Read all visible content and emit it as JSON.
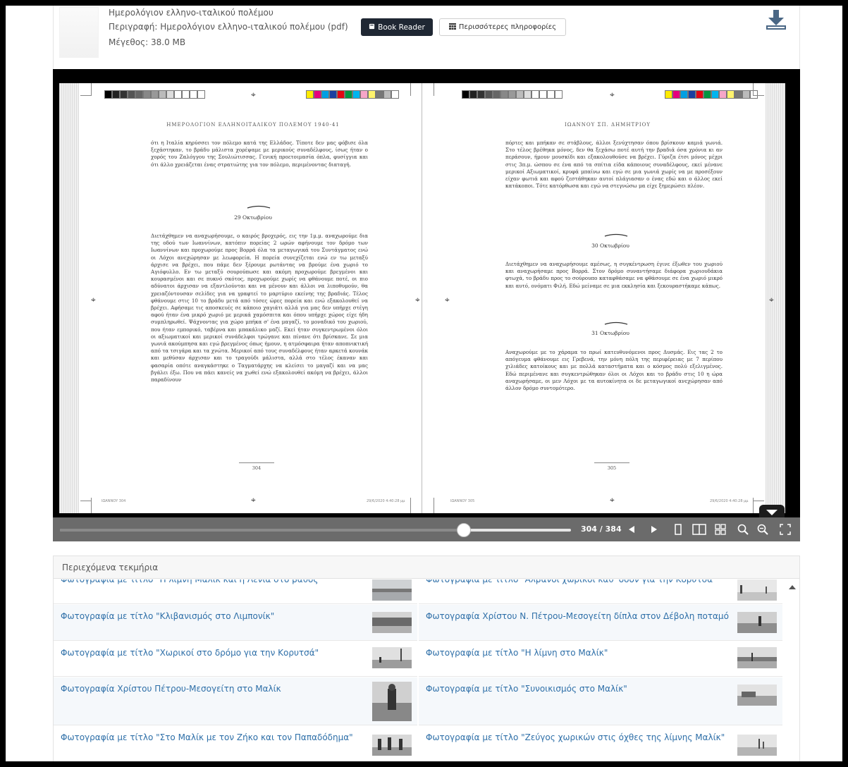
{
  "file": {
    "title": "Ημερολόγιον ελληνο-ιταλικού πολέμου",
    "description": "Περιγραφή: Ημερολόγιον ελληνο-ιταλικού πολέμου (pdf)",
    "size": "Μέγεθος: 38.0 MB",
    "reader_button": "Book Reader",
    "more_button": "Περισσότερες πληροφορίες",
    "download_icon": "download-icon"
  },
  "reader": {
    "left_page": {
      "running_head": "ΗΜΕΡΟΛΟΓΙΟΝ ΕΛΛΗΝΟΙΤΑΛΙΚΟΥ ΠΟΛΕΜΟΥ 1940-41",
      "text_1": "ότι η Ιταλία κηρύσσει τον πόλεμο κατά της Ελλάδος. Τίποτε δεν μας φόβισε όλα ξεχάστηκαν, το βράδυ μάλιστα χορέψαμε με μερικούς συναδέλφους, ίσως ήταν ο χορός του Ζαλόγγου της Σουλιώτισσας. Γενική προετοιμασία όπλα, φυσίγγια και ότι άλλο χρειάζεται ένας στρατιώτης για τον πόλεμο, περιμένοντας διαταγή.",
      "date_head": "29 Οκτωβρίου",
      "text_2": "Διετάχθημεν να αναχωρήσουμε, ο καιρός βροχερός, εις την 1μ.μ. αναχωρούμε δια της οδού των Ιωαννίνων, κατόπιν πορείας 2 ωρών αφήνουμε τον δρόμο των Ιωαννίνων και προχωρούμε προς Βορρά όλα τα μεταγωγικά του Συντάγματος ενώ οι Λόχοι ανεχώρησαν με λεωφορεία. Η πορεία συνεχίζεται ενώ εν τω μεταξύ άρχισε να βρέχει, που πάμε δεν ξέρουμε ρωτάντας να βρούμε ένα χωριό το Αγιόφυλλο. Εν τω μεταξύ σουρούπωσε και ακόμη προχωρούμε βρεγμένοι και κουρασμένοι και σε πυκνό σκότος, προχωρούμε χωρίς να φθάνουμε ποτέ, οι πιο αδύνατοι άρχισαν να εξαντλούνται και να μένουν και άλλοι να λιποθυμούν, θα χρειαζόντουσαν σελίδες για να γραφτεί το μαρτύριο εκείνης της βραδιάς. Τέλος φθάνουμε στις 10 το βράδυ μετά από τόσες ώρες πορεία και ενώ εξακολουθεί να βρέχει. Αφήσαμε τις αποσκευές σε κάποιο χαγιάτι αλλά για μας δεν υπήρχε στέγη αφού ήταν ένα μικρό χωριό με μερικά χαμόσπιτα και όπου υπήρχε χώρος είχε ήδη συμπληρωθεί. Ψάχνοντας για χώρο μπήκα σ' ένα μαγαζί, το μοναδικό του χωριού, που ήταν εμπορικό, ταβέρνα και μπακάλικο μαζί. Εκεί ήταν συγκεντρωμένοι όλοι οι αξιωματικοί και μερικοί συνάδελφοι τρώγανε και πίνανε ότι βρίσκανε. Σε μια γωνιά ακούμπησα και εγώ βρεγμένος όπως ήμουν, η ατμόσφαιρα ήταν αποπνικτική από τα τσιγάρα και τα χνώτα. Μερικοί από τους συναδέλφους ήταν αρκετά κουνάκ και μεθύσαν άρχισαν και το τραγούδι μάλιστα, αλλά στο τέλος έκαναν και φασαρία οπότε αναγκάστηκε ο Ταγματάρχης να κλείσει το μαγαζί και να μας βγάλει έξω. Που να πάει κανείς να χωθεί ενώ εξακολουθεί ακόμη να βρέχει, άλλοι παραδίνουν",
      "page_number": "304",
      "slug_left": "ΙΩΑΝΝΟΥ 304",
      "slug_right": "29/6/2020 4:40:28 μμ"
    },
    "right_page": {
      "running_head": "ΙΩΑΝΝΟΥ ΣΠ. ΔΗΜΗΤΡΙΟΥ",
      "text_1": "πόρτες και μπήκαν σε στάβλους, άλλοι ξενύχτησαν όπου βρίσκουν καμιά γωνιά. Στο τέλος βρέθηκα μόνος, δεν θα ξεχάσω ποτέ αυτή την βραδιά όσα χρόνια κι αν περάσουν, ήμουν μουσκίδι και εξακολουθούσε να βρέχει. Γύριζα έτσι μόνος μέχρι στις 3π.μ. ώσπου σε ένα από τα σπίτια είδα κάποιους συναδέλφους, εκεί μένανε μερικοί Αξιωματικοί, κρυφά μπαίνω και εγώ σε μια γωνιά χωρίς να με προσέξουν είχαν φωτιά και αφού ζεστάθηκαν αυτοί πλάγιασαν ο ένας εδώ και ο άλλος εκεί κατάκοποι. Τότε κατόρθωσα και εγώ να στεγνώσω μα είχε ξημερώσει πλέον.",
      "date_head_1": "30 Οκτωβρίου",
      "text_2": "Διετάχθημεν να αναχωρήσουμε αμέσως, η συγκέντρωση έγινε έξωθεν του χωριού και αναχωρήσαμε προς Βορρά. Στον δρόμο συναντήσαμε διάφορα χωριουδάκια φτωχά, το βράδυ προς το σούρουπο καταφθάσαμε να φθάσουμε σε ένα χωριό μικρό και αυτό, ονόματι Φιλή. Εδώ μείναμε σε μια εκκλησία και ξεκουραστήκαμε κάπως.",
      "date_head_2": "31 Οκτωβρίου",
      "text_3": "Αναχωρούμε με το χάραμα το πρωί κατευθυνόμενοι προς Δυσμάς. Εις τας 2 το απόγευμα φθάνουμε εις Γρεβενά, την μόνη πόλη της περιφέρειας με 7 περίπου χιλιάδες κατοίκους και με πολλά καταστήματα και ο κόσμος πολύ εξελιγμένος. Εδώ περιμένανε και συγκεντρώθηκαν όλοι οι Λόχοι και το βράδυ στις 10 η ώρα αναχωρήσαμε, οι μεν Λόχοι με τα αυτοκίνητα οι δε μεταγωγικοί ανεχώρησαν από άλλον δρόμο συντομότερο.",
      "page_number": "305",
      "slug_left": "ΙΩΑΝΝΟΥ 305",
      "slug_right": "29/6/2020 4:40:28 μμ"
    },
    "progress": 0.79,
    "page_counter": "304 / 384",
    "toolbar_icons": [
      "prev-page-icon",
      "next-page-icon",
      "one-page-view-icon",
      "two-page-view-icon",
      "thumbnail-view-icon",
      "zoom-out-icon",
      "zoom-in-icon",
      "fullscreen-icon"
    ],
    "colors": {
      "reader_bg": "#000000",
      "toolbar_bg": "#6b6b6b"
    }
  },
  "related": {
    "title": "Περιεχόμενα τεκμήρια",
    "items": [
      {
        "label": "Φωτογραφία με τίτλο \"Η λίμνη Μαλίκ και η Λένια στο βάθος\""
      },
      {
        "label": "Φωτογραφία με τίτλο \"Αλβανοί χωρικοί καθ' οδόν για την Κορυτσά\""
      },
      {
        "label": "Φωτογραφία με τίτλο \"Κλιβανισμός στο Λιμπονίκ\""
      },
      {
        "label": "Φωτογραφία Χρίστου Ν. Πέτρου-Μεσογείτη δίπλα στον Δέβολη ποταμό"
      },
      {
        "label": "Φωτογραφία με τίτλο \"Χωρικοί στο δρόμο για την Κορυτσά\""
      },
      {
        "label": "Φωτογραφία με τίτλο \"Η λίμνη στο Μαλίκ\""
      },
      {
        "label": "Φωτογραφία Χρίστου Πέτρου-Μεσογείτη στο Μαλίκ"
      },
      {
        "label": "Φωτογραφία με τίτλο \"Συνοικισμός στο Μαλίκ\""
      },
      {
        "label": "Φωτογραφία με τίτλο \"Στο Μαλίκ με τον Ζήκο και τον Παπαδόδημα\""
      },
      {
        "label": "Φωτογραφία με τίτλο \"Ζεύγος χωρικών στις όχθες της λίμνης Μαλίκ\""
      }
    ],
    "colors": {
      "link": "#2e6fa8"
    }
  }
}
